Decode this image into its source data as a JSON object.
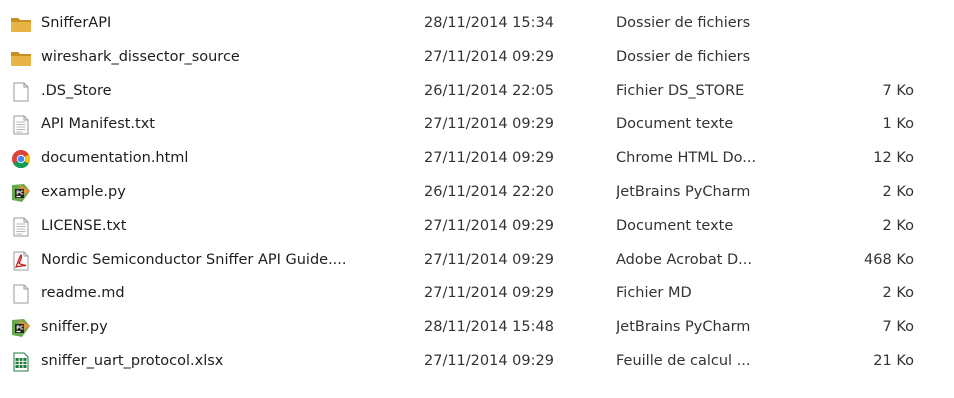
{
  "colors": {
    "folder": "#e8b446",
    "folder_dark": "#c98f1e",
    "pdf": "#c8201e",
    "excel": "#1f7a3c",
    "chrome_red": "#db4437",
    "chrome_yellow": "#f4c20d",
    "chrome_green": "#0f9d58",
    "chrome_blue": "#4285f4",
    "pycharm_green": "#6aa84f",
    "pycharm_orange": "#e69138"
  },
  "files": [
    {
      "icon": "folder-icon",
      "name": "SnifferAPI",
      "date": "28/11/2014 15:34",
      "type": "Dossier de fichiers",
      "size": ""
    },
    {
      "icon": "folder-icon",
      "name": "wireshark_dissector_source",
      "date": "27/11/2014 09:29",
      "type": "Dossier de fichiers",
      "size": ""
    },
    {
      "icon": "blank-file-icon",
      "name": ".DS_Store",
      "date": "26/11/2014 22:05",
      "type": "Fichier DS_STORE",
      "size": "7 Ko"
    },
    {
      "icon": "text-file-icon",
      "name": "API Manifest.txt",
      "date": "27/11/2014 09:29",
      "type": "Document texte",
      "size": "1 Ko"
    },
    {
      "icon": "chrome-icon",
      "name": "documentation.html",
      "date": "27/11/2014 09:29",
      "type": "Chrome HTML Do...",
      "size": "12 Ko"
    },
    {
      "icon": "pycharm-icon",
      "name": "example.py",
      "date": "26/11/2014 22:20",
      "type": "JetBrains PyCharm",
      "size": "2 Ko"
    },
    {
      "icon": "text-file-icon",
      "name": "LICENSE.txt",
      "date": "27/11/2014 09:29",
      "type": "Document texte",
      "size": "2 Ko"
    },
    {
      "icon": "pdf-icon",
      "name": "Nordic Semiconductor Sniffer API Guide....",
      "date": "27/11/2014 09:29",
      "type": "Adobe Acrobat D...",
      "size": "468 Ko"
    },
    {
      "icon": "blank-file-icon",
      "name": "readme.md",
      "date": "27/11/2014 09:29",
      "type": "Fichier MD",
      "size": "2 Ko"
    },
    {
      "icon": "pycharm-icon",
      "name": "sniffer.py",
      "date": "28/11/2014 15:48",
      "type": "JetBrains PyCharm",
      "size": "7 Ko"
    },
    {
      "icon": "excel-icon",
      "name": "sniffer_uart_protocol.xlsx",
      "date": "27/11/2014 09:29",
      "type": "Feuille de calcul ...",
      "size": "21 Ko"
    }
  ]
}
